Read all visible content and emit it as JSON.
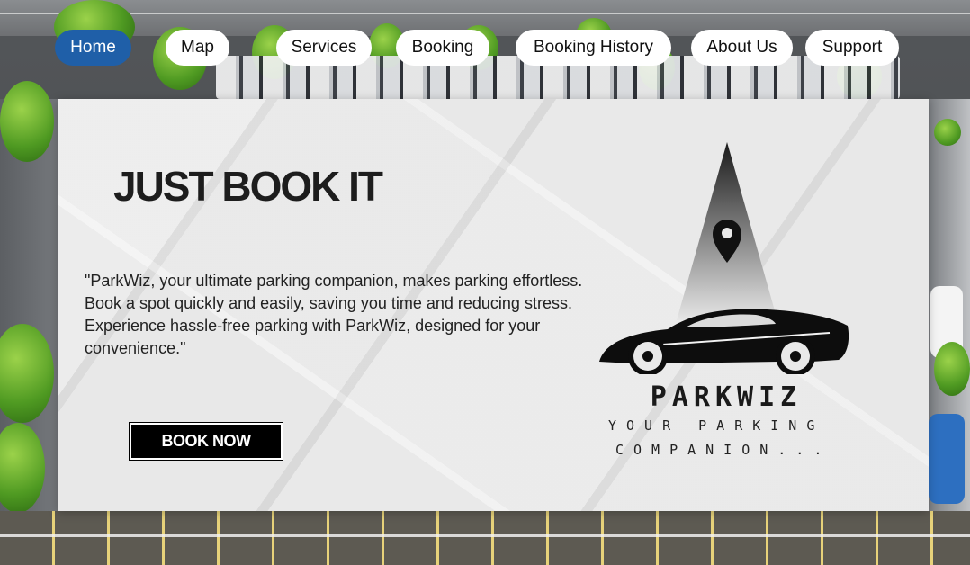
{
  "nav": {
    "items": [
      {
        "label": "Home",
        "active": true
      },
      {
        "label": "Map"
      },
      {
        "label": "Services"
      },
      {
        "label": "Booking"
      },
      {
        "label": "Booking History"
      },
      {
        "label": "About Us"
      },
      {
        "label": "Support"
      }
    ]
  },
  "hero": {
    "headline": "JUST BOOK IT",
    "description": "\"ParkWiz, your ultimate parking companion, makes parking effortless. Book a spot quickly and easily, saving you time and reducing stress. Experience hassle-free parking with ParkWiz, designed for your convenience.\"",
    "cta_label": "BOOK NOW"
  },
  "logo": {
    "title": "PARKWIZ",
    "tagline_line1": "YOUR PARKING",
    "tagline_line2": "COMPANION..."
  },
  "colors": {
    "nav_active": "#1f5fa8",
    "nav_inactive": "#ffffff",
    "cta_background": "#000000",
    "paper": "#e9e9e9"
  },
  "icons": [
    "location-pin-icon",
    "sports-car-icon"
  ]
}
